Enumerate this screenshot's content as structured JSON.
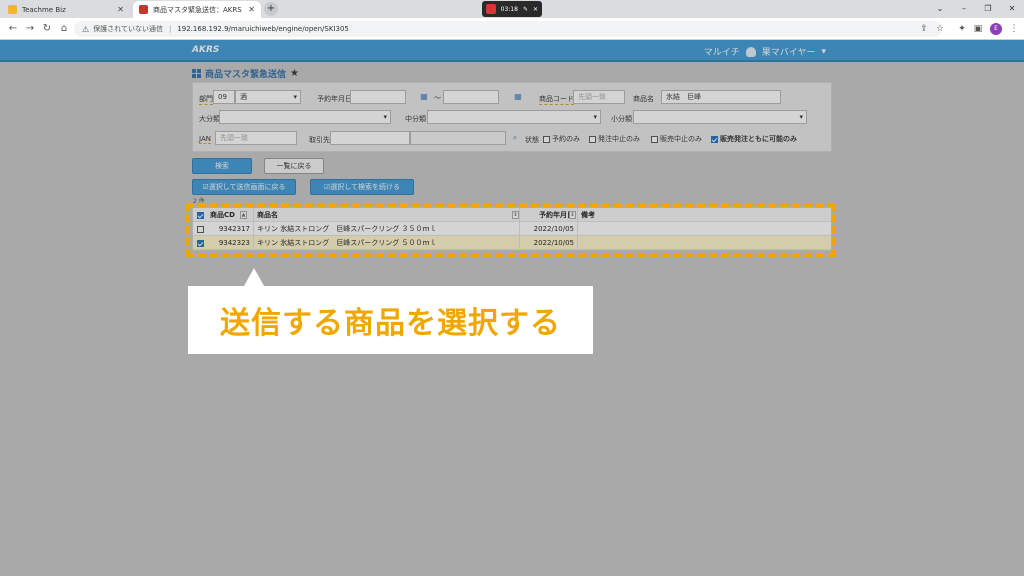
{
  "browser": {
    "tabs": [
      {
        "title": "Teachme Biz",
        "active": false
      },
      {
        "title": "商品マスタ緊急送信：AKRS",
        "active": true
      }
    ],
    "new_tab": "+",
    "recorder_time": "03:18",
    "url_security": "保護されていない通信",
    "url_path": "192.168.192.9/maruichiweb/engine/open/SKI305"
  },
  "app": {
    "logo": "AKRS",
    "user_company": "マルイチ",
    "user_role": "果マバイヤー"
  },
  "page": {
    "title": "商品マスタ緊急送信"
  },
  "search": {
    "dept_label": "部門",
    "dept_code": "09",
    "dept_name": "酒",
    "date_label": "予約年月日",
    "date_sep": "～",
    "product_code_label": "商品コード",
    "product_code_placeholder": "先頭一致",
    "product_name_label": "商品名",
    "product_name_value": "氷結　巨峰",
    "category_l_label": "大分類",
    "category_m_label": "中分類",
    "category_s_label": "小分類",
    "jan_label": "JAN",
    "jan_placeholder": "先頭一致",
    "supplier_label": "取引先",
    "status_label": "状態",
    "status_options": [
      {
        "label": "予約のみ",
        "checked": false
      },
      {
        "label": "発注中止のみ",
        "checked": false
      },
      {
        "label": "販売中止のみ",
        "checked": false
      },
      {
        "label": "販売発注ともに可能のみ",
        "checked": true
      }
    ]
  },
  "buttons": {
    "search": "検索",
    "back_to_list": "一覧に戻る",
    "select_and_send": "☑選択して送信画面に戻る",
    "select_and_continue": "☑選択して検索を続ける"
  },
  "results": {
    "count_label": "2 件",
    "columns": {
      "code": "商品CD",
      "name": "商品名",
      "date": "予約年月日",
      "note": "備考"
    },
    "rows": [
      {
        "checked": false,
        "code": "9342317",
        "name": "キリン 氷結ストロング　巨峰スパークリング ３５０ｍｌ",
        "date": "2022/10/05",
        "note": ""
      },
      {
        "checked": true,
        "code": "9342323",
        "name": "キリン 氷結ストロング　巨峰スパークリング ５００ｍｌ",
        "date": "2022/10/05",
        "note": ""
      }
    ]
  },
  "annotation": {
    "callout_text": "送信する商品を選択する",
    "highlight_color": "#f0a800"
  },
  "colors": {
    "header_blue": "#3d9ad6",
    "selected_row": "#fff7cc"
  }
}
